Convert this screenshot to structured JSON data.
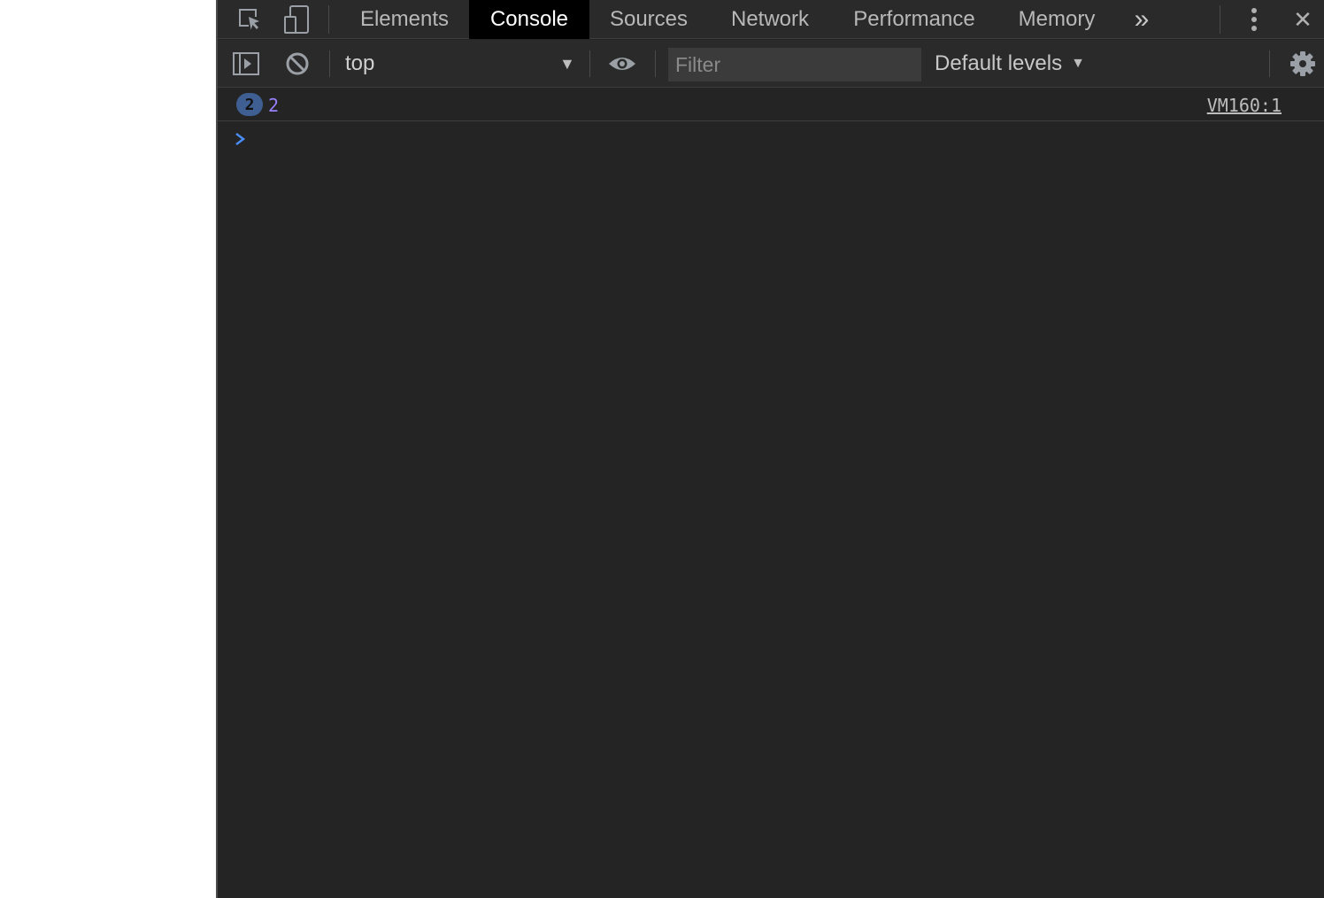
{
  "devtools": {
    "tabs": [
      {
        "label": "Elements",
        "active": false
      },
      {
        "label": "Console",
        "active": true
      },
      {
        "label": "Sources",
        "active": false
      },
      {
        "label": "Network",
        "active": false
      },
      {
        "label": "Performance",
        "active": false
      },
      {
        "label": "Memory",
        "active": false
      }
    ],
    "more_tabs_glyph": "»",
    "close_glyph": "✕"
  },
  "console_toolbar": {
    "context": "top",
    "filter_placeholder": "Filter",
    "filter_value": "",
    "levels_label": "Default levels"
  },
  "console": {
    "messages": [
      {
        "count": "2",
        "value": "2",
        "source": "VM160:1"
      }
    ],
    "prompt_value": ""
  },
  "colors": {
    "panel_background": "#242424",
    "active_tab_background": "#000000",
    "number_value": "#9980ff",
    "count_badge": "#3f5f92",
    "prompt_chevron": "#4a8cf7"
  },
  "icons": [
    "inspect-element-icon",
    "device-toolbar-icon",
    "more-tabs-icon",
    "kebab-menu-icon",
    "close-icon",
    "sidebar-toggle-icon",
    "clear-console-icon",
    "dropdown-arrow-icon",
    "eye-icon",
    "settings-gear-icon",
    "prompt-chevron-icon"
  ]
}
